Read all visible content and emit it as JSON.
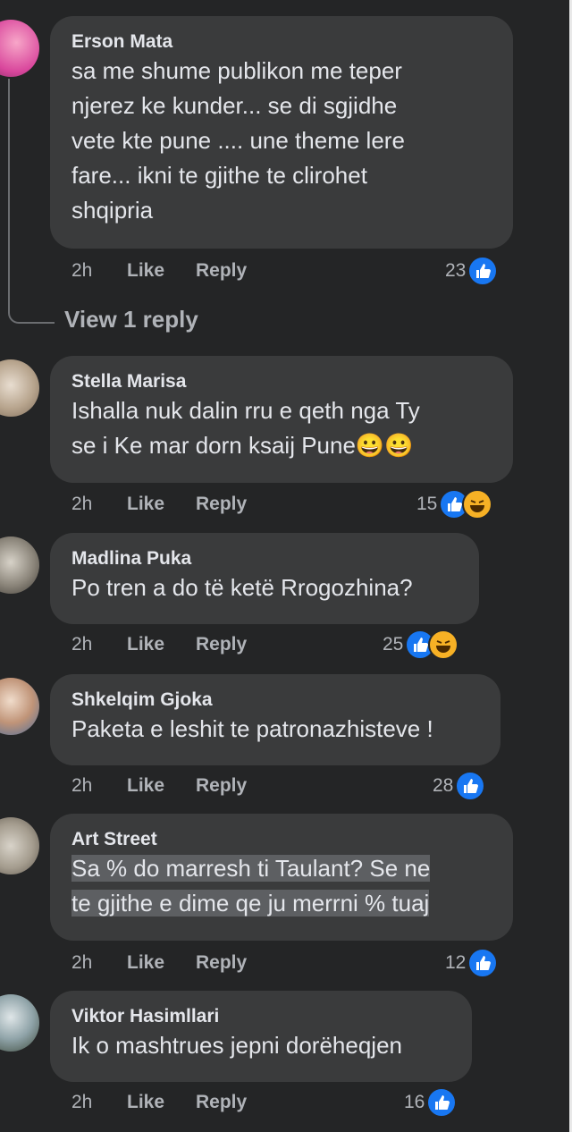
{
  "actions": {
    "like": "Like",
    "reply": "Reply"
  },
  "view_replies": "View 1 reply",
  "colors": {
    "background": "#242526",
    "bubble": "#3a3b3c",
    "like_blue": "#1877f2",
    "haha_yellow": "#f7b125"
  },
  "comments": [
    {
      "author": "Erson Mata",
      "text": "sa me shume publikon me teper\nnjerez ke kunder... se di sgjidhe\nvete kte pune .... une theme lere\nfare... ikni te gjithe te clirohet\nshqipria",
      "time": "2h",
      "reaction_count": "23",
      "reactions": [
        "like-icon"
      ]
    },
    {
      "author": "Stella Marisa",
      "text": "Ishalla nuk dalin rru e qeth nga Ty\nse i Ke mar dorn ksaij Pune😀😀",
      "time": "2h",
      "reaction_count": "15",
      "reactions": [
        "like-icon",
        "haha-icon"
      ]
    },
    {
      "author": "Madlina Puka",
      "text": "Po tren a do të ketë Rrogozhina?",
      "time": "2h",
      "reaction_count": "25",
      "reactions": [
        "like-icon",
        "haha-icon"
      ]
    },
    {
      "author": "Shkelqim Gjoka",
      "text": "Paketa e leshit te patronazhisteve !",
      "time": "2h",
      "reaction_count": "28",
      "reactions": [
        "like-icon"
      ]
    },
    {
      "author": "Art Street",
      "text": "Sa % do marresh ti Taulant? Se ne\nte gjithe e dime qe ju merrni % tuaj",
      "time": "2h",
      "reaction_count": "12",
      "reactions": [
        "like-icon"
      ]
    },
    {
      "author": "Viktor Hasimllari",
      "text": "Ik o mashtrues jepni dorëheqjen",
      "time": "2h",
      "reaction_count": "16",
      "reactions": [
        "like-icon"
      ]
    }
  ]
}
